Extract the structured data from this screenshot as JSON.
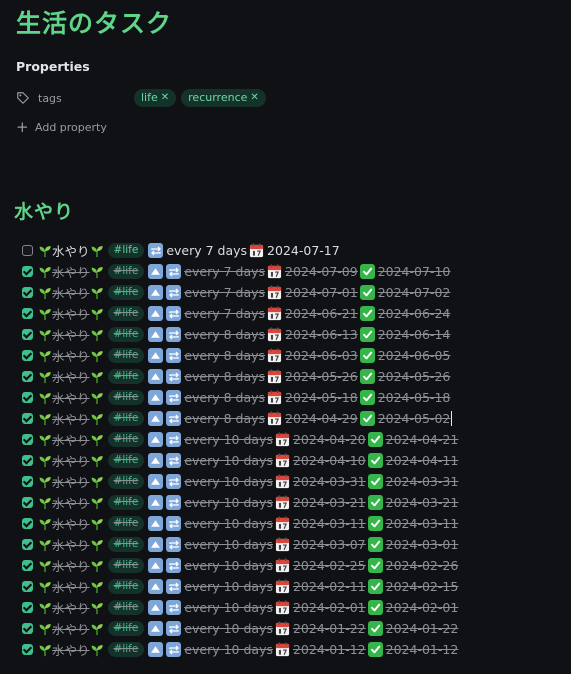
{
  "page": {
    "title": "生活のタスク"
  },
  "properties": {
    "heading": "Properties",
    "tags_label": "tags",
    "tag_values": [
      "life",
      "recurrence"
    ],
    "add_property_label": "Add property"
  },
  "section": {
    "heading": "水やり"
  },
  "tasks": [
    {
      "done": false,
      "text": "水やり",
      "tag": "#life",
      "recurrence": "every 7 days",
      "due": "2024-07-17",
      "completed": ""
    },
    {
      "done": true,
      "text": "水やり",
      "tag": "#life",
      "recurrence": "every 7 days",
      "due": "2024-07-09",
      "completed": "2024-07-10"
    },
    {
      "done": true,
      "text": "水やり",
      "tag": "#life",
      "recurrence": "every 7 days",
      "due": "2024-07-01",
      "completed": "2024-07-02"
    },
    {
      "done": true,
      "text": "水やり",
      "tag": "#life",
      "recurrence": "every 7 days",
      "due": "2024-06-21",
      "completed": "2024-06-24"
    },
    {
      "done": true,
      "text": "水やり",
      "tag": "#life",
      "recurrence": "every 8 days",
      "due": "2024-06-13",
      "completed": "2024-06-14"
    },
    {
      "done": true,
      "text": "水やり",
      "tag": "#life",
      "recurrence": "every 8 days",
      "due": "2024-06-03",
      "completed": "2024-06-05"
    },
    {
      "done": true,
      "text": "水やり",
      "tag": "#life",
      "recurrence": "every 8 days",
      "due": "2024-05-26",
      "completed": "2024-05-26"
    },
    {
      "done": true,
      "text": "水やり",
      "tag": "#life",
      "recurrence": "every 8 days",
      "due": "2024-05-18",
      "completed": "2024-05-18"
    },
    {
      "done": true,
      "text": "水やり",
      "tag": "#life",
      "recurrence": "every 8 days",
      "due": "2024-04-29",
      "completed": "2024-05-02"
    },
    {
      "done": true,
      "text": "水やり",
      "tag": "#life",
      "recurrence": "every 10 days",
      "due": "2024-04-20",
      "completed": "2024-04-21"
    },
    {
      "done": true,
      "text": "水やり",
      "tag": "#life",
      "recurrence": "every 10 days",
      "due": "2024-04-10",
      "completed": "2024-04-11"
    },
    {
      "done": true,
      "text": "水やり",
      "tag": "#life",
      "recurrence": "every 10 days",
      "due": "2024-03-31",
      "completed": "2024-03-31"
    },
    {
      "done": true,
      "text": "水やり",
      "tag": "#life",
      "recurrence": "every 10 days",
      "due": "2024-03-21",
      "completed": "2024-03-21"
    },
    {
      "done": true,
      "text": "水やり",
      "tag": "#life",
      "recurrence": "every 10 days",
      "due": "2024-03-11",
      "completed": "2024-03-11"
    },
    {
      "done": true,
      "text": "水やり",
      "tag": "#life",
      "recurrence": "every 10 days",
      "due": "2024-03-07",
      "completed": "2024-03-01"
    },
    {
      "done": true,
      "text": "水やり",
      "tag": "#life",
      "recurrence": "every 10 days",
      "due": "2024-02-25",
      "completed": "2024-02-26"
    },
    {
      "done": true,
      "text": "水やり",
      "tag": "#life",
      "recurrence": "every 10 days",
      "due": "2024-02-11",
      "completed": "2024-02-15"
    },
    {
      "done": true,
      "text": "水やり",
      "tag": "#life",
      "recurrence": "every 10 days",
      "due": "2024-02-01",
      "completed": "2024-02-01"
    },
    {
      "done": true,
      "text": "水やり",
      "tag": "#life",
      "recurrence": "every 10 days",
      "due": "2024-01-22",
      "completed": "2024-01-22"
    },
    {
      "done": true,
      "text": "水やり",
      "tag": "#life",
      "recurrence": "every 10 days",
      "due": "2024-01-12",
      "completed": "2024-01-12"
    }
  ],
  "icons": {
    "tags": "tag-icon",
    "add": "plus-icon",
    "remove": "close-icon",
    "sprout": "seedling-icon",
    "priority": "priority-up-icon",
    "recurrence": "repeat-icon",
    "due": "calendar-icon",
    "completed": "check-mark-icon"
  },
  "colors": {
    "heading": "#5fd58a",
    "tag_bg": "#15322a",
    "tag_text": "#6fd7a8",
    "checkbox_done": "#3fbe8e"
  }
}
